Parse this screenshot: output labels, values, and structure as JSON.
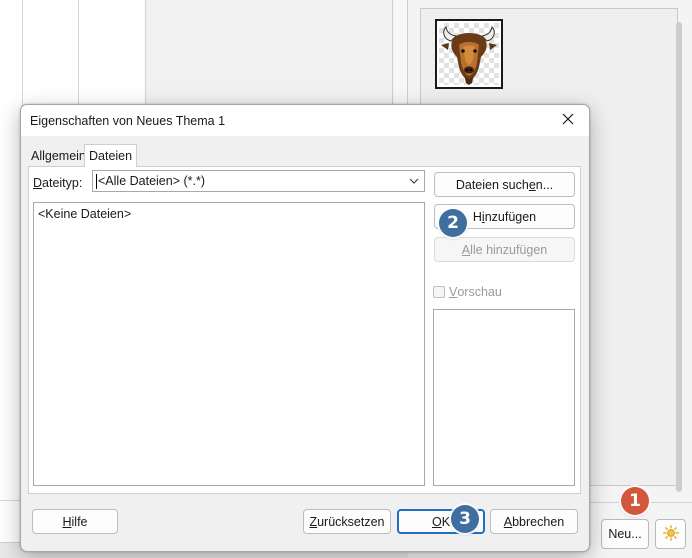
{
  "dialog": {
    "title": "Eigenschaften von Neues Thema 1",
    "tabs": [
      {
        "label": "Allgemein",
        "active": false
      },
      {
        "label": "Dateien",
        "active": true
      }
    ],
    "filetype": {
      "label_prefix": "D",
      "label_rest": "ateityp:",
      "value": "<Alle Dateien> (*.*)"
    },
    "file_list_empty": "<Keine Dateien>",
    "buttons": {
      "search_pre": "Dateien such",
      "search_u": "e",
      "search_post": "n...",
      "add_pre": "H",
      "add_u": "i",
      "add_post": "nzufügen",
      "add_all_u": "A",
      "add_all_post": "lle hinzufügen",
      "help_u": "H",
      "help_post": "ilfe",
      "reset_u": "Z",
      "reset_post": "urücksetzen",
      "ok_u": "O",
      "ok_post": "K",
      "cancel_u": "A",
      "cancel_post": "bbrechen"
    },
    "preview": {
      "label_u": "V",
      "label_post": "orschau",
      "checked": false
    }
  },
  "gallery": {
    "thumbnail_icon": "bison-icon",
    "new_button": "Neu...",
    "properties_icon": "sun-icon"
  },
  "callouts": [
    {
      "number": "1",
      "color": "#d2573b"
    },
    {
      "number": "2",
      "color": "#3f6f9f"
    },
    {
      "number": "3",
      "color": "#3f6f9f"
    }
  ]
}
